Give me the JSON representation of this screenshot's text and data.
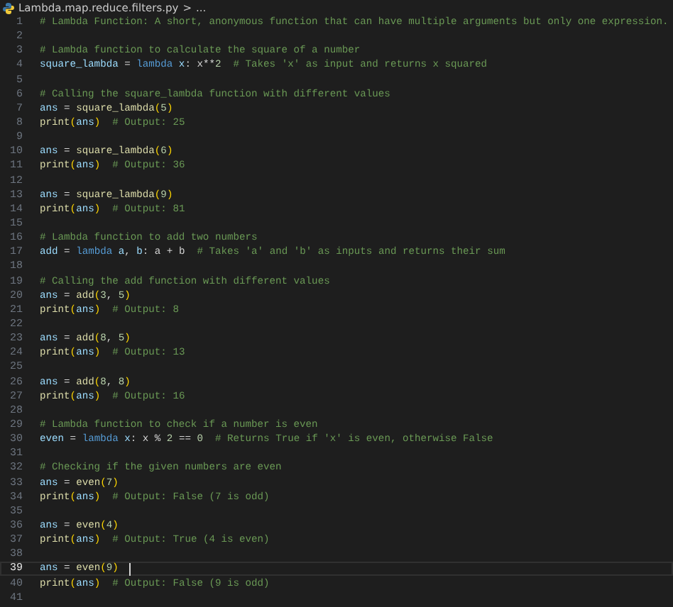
{
  "breadcrumb": {
    "file": "Lambda.map.reduce.filters.py",
    "separator": ">",
    "more": "..."
  },
  "lines": [
    {
      "number": "1",
      "current": false,
      "tokens": [
        {
          "kind": "comment",
          "text": "# Lambda Function: A short, anonymous function that can have multiple arguments but only one expression."
        }
      ]
    },
    {
      "number": "2",
      "current": false
    },
    {
      "number": "3",
      "current": false,
      "tokens": [
        {
          "kind": "comment",
          "text": "# Lambda function to calculate the square of a number"
        }
      ]
    },
    {
      "number": "4",
      "current": false,
      "tokens": [
        {
          "kind": "variable",
          "text": "square_lambda"
        },
        {
          "kind": "plain",
          "text": " = "
        },
        {
          "kind": "keyword",
          "text": "lambda"
        },
        {
          "kind": "variable",
          "text": " x"
        },
        {
          "kind": "plain",
          "text": ": x**"
        },
        {
          "kind": "number",
          "text": "2"
        },
        {
          "kind": "comment",
          "text": "  # Takes 'x' as input and returns x squared"
        }
      ]
    },
    {
      "number": "5",
      "current": false
    },
    {
      "number": "6",
      "current": false,
      "tokens": [
        {
          "kind": "comment",
          "text": "# Calling the square_lambda function with different values"
        }
      ]
    },
    {
      "number": "7",
      "current": false,
      "tokens": [
        {
          "kind": "variable",
          "text": "ans"
        },
        {
          "kind": "plain",
          "text": " = "
        },
        {
          "kind": "function",
          "text": "square_lambda"
        },
        {
          "kind": "bracket",
          "text": "("
        },
        {
          "kind": "number",
          "text": "5"
        },
        {
          "kind": "bracket",
          "text": ")"
        }
      ]
    },
    {
      "number": "8",
      "current": false,
      "tokens": [
        {
          "kind": "function",
          "text": "print"
        },
        {
          "kind": "bracket",
          "text": "("
        },
        {
          "kind": "variable",
          "text": "ans"
        },
        {
          "kind": "bracket",
          "text": ")"
        },
        {
          "kind": "comment",
          "text": "  # Output: 25"
        }
      ]
    },
    {
      "number": "9",
      "current": false
    },
    {
      "number": "10",
      "current": false,
      "tokens": [
        {
          "kind": "variable",
          "text": "ans"
        },
        {
          "kind": "plain",
          "text": " = "
        },
        {
          "kind": "function",
          "text": "square_lambda"
        },
        {
          "kind": "bracket",
          "text": "("
        },
        {
          "kind": "number",
          "text": "6"
        },
        {
          "kind": "bracket",
          "text": ")"
        }
      ]
    },
    {
      "number": "11",
      "current": false,
      "tokens": [
        {
          "kind": "function",
          "text": "print"
        },
        {
          "kind": "bracket",
          "text": "("
        },
        {
          "kind": "variable",
          "text": "ans"
        },
        {
          "kind": "bracket",
          "text": ")"
        },
        {
          "kind": "comment",
          "text": "  # Output: 36"
        }
      ]
    },
    {
      "number": "12",
      "current": false
    },
    {
      "number": "13",
      "current": false,
      "tokens": [
        {
          "kind": "variable",
          "text": "ans"
        },
        {
          "kind": "plain",
          "text": " = "
        },
        {
          "kind": "function",
          "text": "square_lambda"
        },
        {
          "kind": "bracket",
          "text": "("
        },
        {
          "kind": "number",
          "text": "9"
        },
        {
          "kind": "bracket",
          "text": ")"
        }
      ]
    },
    {
      "number": "14",
      "current": false,
      "tokens": [
        {
          "kind": "function",
          "text": "print"
        },
        {
          "kind": "bracket",
          "text": "("
        },
        {
          "kind": "variable",
          "text": "ans"
        },
        {
          "kind": "bracket",
          "text": ")"
        },
        {
          "kind": "comment",
          "text": "  # Output: 81"
        }
      ]
    },
    {
      "number": "15",
      "current": false
    },
    {
      "number": "16",
      "current": false,
      "tokens": [
        {
          "kind": "comment",
          "text": "# Lambda function to add two numbers"
        }
      ]
    },
    {
      "number": "17",
      "current": false,
      "tokens": [
        {
          "kind": "variable",
          "text": "add"
        },
        {
          "kind": "plain",
          "text": " = "
        },
        {
          "kind": "keyword",
          "text": "lambda"
        },
        {
          "kind": "variable",
          "text": " a"
        },
        {
          "kind": "plain",
          "text": ", "
        },
        {
          "kind": "variable",
          "text": "b"
        },
        {
          "kind": "plain",
          "text": ": a + b"
        },
        {
          "kind": "comment",
          "text": "  # Takes 'a' and 'b' as inputs and returns their sum"
        }
      ]
    },
    {
      "number": "18",
      "current": false
    },
    {
      "number": "19",
      "current": false,
      "tokens": [
        {
          "kind": "comment",
          "text": "# Calling the add function with different values"
        }
      ]
    },
    {
      "number": "20",
      "current": false,
      "tokens": [
        {
          "kind": "variable",
          "text": "ans"
        },
        {
          "kind": "plain",
          "text": " = "
        },
        {
          "kind": "function",
          "text": "add"
        },
        {
          "kind": "bracket",
          "text": "("
        },
        {
          "kind": "number",
          "text": "3"
        },
        {
          "kind": "plain",
          "text": ", "
        },
        {
          "kind": "number",
          "text": "5"
        },
        {
          "kind": "bracket",
          "text": ")"
        }
      ]
    },
    {
      "number": "21",
      "current": false,
      "tokens": [
        {
          "kind": "function",
          "text": "print"
        },
        {
          "kind": "bracket",
          "text": "("
        },
        {
          "kind": "variable",
          "text": "ans"
        },
        {
          "kind": "bracket",
          "text": ")"
        },
        {
          "kind": "comment",
          "text": "  # Output: 8"
        }
      ]
    },
    {
      "number": "22",
      "current": false
    },
    {
      "number": "23",
      "current": false,
      "tokens": [
        {
          "kind": "variable",
          "text": "ans"
        },
        {
          "kind": "plain",
          "text": " = "
        },
        {
          "kind": "function",
          "text": "add"
        },
        {
          "kind": "bracket",
          "text": "("
        },
        {
          "kind": "number",
          "text": "8"
        },
        {
          "kind": "plain",
          "text": ", "
        },
        {
          "kind": "number",
          "text": "5"
        },
        {
          "kind": "bracket",
          "text": ")"
        }
      ]
    },
    {
      "number": "24",
      "current": false,
      "tokens": [
        {
          "kind": "function",
          "text": "print"
        },
        {
          "kind": "bracket",
          "text": "("
        },
        {
          "kind": "variable",
          "text": "ans"
        },
        {
          "kind": "bracket",
          "text": ")"
        },
        {
          "kind": "comment",
          "text": "  # Output: 13"
        }
      ]
    },
    {
      "number": "25",
      "current": false
    },
    {
      "number": "26",
      "current": false,
      "tokens": [
        {
          "kind": "variable",
          "text": "ans"
        },
        {
          "kind": "plain",
          "text": " = "
        },
        {
          "kind": "function",
          "text": "add"
        },
        {
          "kind": "bracket",
          "text": "("
        },
        {
          "kind": "number",
          "text": "8"
        },
        {
          "kind": "plain",
          "text": ", "
        },
        {
          "kind": "number",
          "text": "8"
        },
        {
          "kind": "bracket",
          "text": ")"
        }
      ]
    },
    {
      "number": "27",
      "current": false,
      "tokens": [
        {
          "kind": "function",
          "text": "print"
        },
        {
          "kind": "bracket",
          "text": "("
        },
        {
          "kind": "variable",
          "text": "ans"
        },
        {
          "kind": "bracket",
          "text": ")"
        },
        {
          "kind": "comment",
          "text": "  # Output: 16"
        }
      ]
    },
    {
      "number": "28",
      "current": false
    },
    {
      "number": "29",
      "current": false,
      "tokens": [
        {
          "kind": "comment",
          "text": "# Lambda function to check if a number is even"
        }
      ]
    },
    {
      "number": "30",
      "current": false,
      "tokens": [
        {
          "kind": "variable",
          "text": "even"
        },
        {
          "kind": "plain",
          "text": " = "
        },
        {
          "kind": "keyword",
          "text": "lambda"
        },
        {
          "kind": "variable",
          "text": " x"
        },
        {
          "kind": "plain",
          "text": ": x % "
        },
        {
          "kind": "number",
          "text": "2"
        },
        {
          "kind": "plain",
          "text": " == "
        },
        {
          "kind": "number",
          "text": "0"
        },
        {
          "kind": "comment",
          "text": "  # Returns True if 'x' is even, otherwise False"
        }
      ]
    },
    {
      "number": "31",
      "current": false
    },
    {
      "number": "32",
      "current": false,
      "tokens": [
        {
          "kind": "comment",
          "text": "# Checking if the given numbers are even"
        }
      ]
    },
    {
      "number": "33",
      "current": false,
      "tokens": [
        {
          "kind": "variable",
          "text": "ans"
        },
        {
          "kind": "plain",
          "text": " = "
        },
        {
          "kind": "function",
          "text": "even"
        },
        {
          "kind": "bracket",
          "text": "("
        },
        {
          "kind": "number",
          "text": "7"
        },
        {
          "kind": "bracket",
          "text": ")"
        }
      ]
    },
    {
      "number": "34",
      "current": false,
      "tokens": [
        {
          "kind": "function",
          "text": "print"
        },
        {
          "kind": "bracket",
          "text": "("
        },
        {
          "kind": "variable",
          "text": "ans"
        },
        {
          "kind": "bracket",
          "text": ")"
        },
        {
          "kind": "comment",
          "text": "  # Output: False (7 is odd)"
        }
      ]
    },
    {
      "number": "35",
      "current": false
    },
    {
      "number": "36",
      "current": false,
      "tokens": [
        {
          "kind": "variable",
          "text": "ans"
        },
        {
          "kind": "plain",
          "text": " = "
        },
        {
          "kind": "function",
          "text": "even"
        },
        {
          "kind": "bracket",
          "text": "("
        },
        {
          "kind": "number",
          "text": "4"
        },
        {
          "kind": "bracket",
          "text": ")"
        }
      ]
    },
    {
      "number": "37",
      "current": false,
      "tokens": [
        {
          "kind": "function",
          "text": "print"
        },
        {
          "kind": "bracket",
          "text": "("
        },
        {
          "kind": "variable",
          "text": "ans"
        },
        {
          "kind": "bracket",
          "text": ")"
        },
        {
          "kind": "comment",
          "text": "  # Output: True (4 is even)"
        }
      ]
    },
    {
      "number": "38",
      "current": false
    },
    {
      "number": "39",
      "current": true,
      "tokens": [
        {
          "kind": "variable",
          "text": "ans"
        },
        {
          "kind": "plain",
          "text": " = "
        },
        {
          "kind": "function",
          "text": "even"
        },
        {
          "kind": "bracket",
          "text": "("
        },
        {
          "kind": "number",
          "text": "9"
        },
        {
          "kind": "bracket",
          "text": ")"
        }
      ]
    },
    {
      "number": "40",
      "current": false,
      "tokens": [
        {
          "kind": "function",
          "text": "print"
        },
        {
          "kind": "bracket",
          "text": "("
        },
        {
          "kind": "variable",
          "text": "ans"
        },
        {
          "kind": "bracket",
          "text": ")"
        },
        {
          "kind": "comment",
          "text": "  # Output: False (9 is odd)"
        }
      ]
    },
    {
      "number": "41",
      "current": false
    }
  ]
}
